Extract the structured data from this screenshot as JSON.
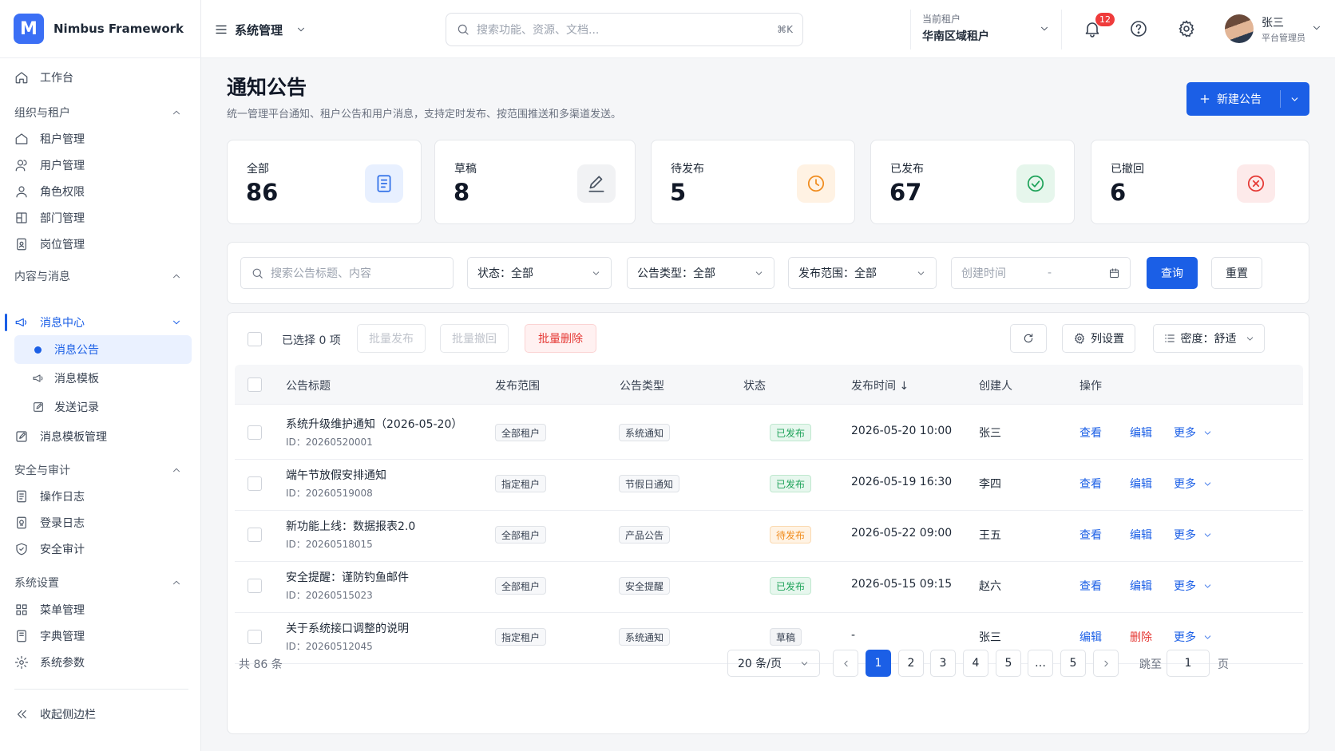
{
  "brand": {
    "logo_letter": "M",
    "name": "Nimbus Framework",
    "accent": "#1b5fe6"
  },
  "sidebar": {
    "workbench": "工作台",
    "groups": [
      {
        "label": "组织与租户",
        "items": [
          "租户管理",
          "用户管理",
          "角色权限",
          "部门管理",
          "岗位管理"
        ]
      },
      {
        "label": "内容与消息",
        "active_item": "消息中心",
        "sub_items": [
          "消息公告",
          "消息模板",
          "发送记录"
        ],
        "items": [
          "消息模板管理"
        ]
      },
      {
        "label": "安全与审计",
        "items": [
          "操作日志",
          "登录日志",
          "安全审计"
        ]
      },
      {
        "label": "系统设置",
        "items": [
          "菜单管理",
          "字典管理",
          "系统参数"
        ]
      }
    ],
    "collapse": "收起侧边栏"
  },
  "topbar": {
    "menu_label": "系统管理",
    "search_placeholder": "搜索功能、资源、文档...",
    "search_shortcut": "⌘K",
    "tenant_label": "当前租户",
    "tenant_value": "华南区域租户",
    "notification_count": "12",
    "user_name": "张三",
    "user_role": "平台管理员"
  },
  "page": {
    "title": "通知公告",
    "description": "统一管理平台通知、租户公告和用户消息，支持定时发布、按范围推送和多渠道发送。",
    "new_button": "新建公告"
  },
  "stats": [
    {
      "label": "全部",
      "value": "86",
      "icon": "document-icon",
      "color": "#2f6fe8",
      "bg": "#e8f0ff"
    },
    {
      "label": "草稿",
      "value": "8",
      "icon": "edit-icon",
      "color": "#4b5563",
      "bg": "#f1f2f4"
    },
    {
      "label": "待发布",
      "value": "5",
      "icon": "clock-icon",
      "color": "#f08c1e",
      "bg": "#fff2e3"
    },
    {
      "label": "已发布",
      "value": "67",
      "icon": "check-circle-icon",
      "color": "#1fa35a",
      "bg": "#e6f6ec"
    },
    {
      "label": "已撤回",
      "value": "6",
      "icon": "x-circle-icon",
      "color": "#e53935",
      "bg": "#fdeaea"
    }
  ],
  "filters": {
    "search_placeholder": "搜索公告标题、内容",
    "status": "状态：全部",
    "type": "公告类型：全部",
    "scope": "发布范围：全部",
    "date_placeholder": "创建时间",
    "date_separator": "-",
    "query_button": "查询",
    "reset_button": "重置"
  },
  "toolbar": {
    "selected": "已选择 0 项",
    "batch_publish": "批量发布",
    "batch_revoke": "批量撤回",
    "batch_delete": "批量删除",
    "columns": "列设置",
    "density": "密度：舒适"
  },
  "table": {
    "columns": [
      "公告标题",
      "发布范围",
      "公告类型",
      "状态",
      "发布时间 ↓",
      "创建人",
      "操作"
    ],
    "rows": [
      {
        "title": "系统升级维护通知（2026-05-20）",
        "id": "ID：20260520001",
        "scope": "全部租户",
        "type": "系统通知",
        "status": "已发布",
        "status_kind": "published",
        "time": "2026-05-20 10:00",
        "creator": "张三",
        "action1": "查看",
        "action2": "编辑",
        "more": "更多"
      },
      {
        "title": "端午节放假安排通知",
        "id": "ID：20260519008",
        "scope": "指定租户",
        "type": "节假日通知",
        "status": "已发布",
        "status_kind": "published",
        "time": "2026-05-19 16:30",
        "creator": "李四",
        "action1": "查看",
        "action2": "编辑",
        "more": "更多"
      },
      {
        "title": "新功能上线：数据报表2.0",
        "id": "ID：20260518015",
        "scope": "全部租户",
        "type": "产品公告",
        "status": "待发布",
        "status_kind": "pending",
        "time": "2026-05-22 09:00",
        "creator": "王五",
        "action1": "查看",
        "action2": "编辑",
        "more": "更多"
      },
      {
        "title": "安全提醒：谨防钓鱼邮件",
        "id": "ID：20260515023",
        "scope": "全部租户",
        "type": "安全提醒",
        "status": "已发布",
        "status_kind": "published",
        "time": "2026-05-15 09:15",
        "creator": "赵六",
        "action1": "查看",
        "action2": "编辑",
        "more": "更多"
      },
      {
        "title": "关于系统接口调整的说明",
        "id": "ID：20260512045",
        "scope": "指定租户",
        "type": "系统通知",
        "status": "草稿",
        "status_kind": "draft",
        "time": "-",
        "creator": "张三",
        "action1": "编辑",
        "action2": "删除",
        "more": "更多"
      }
    ]
  },
  "pagination": {
    "total": "共 86 条",
    "page_size": "20 条/页",
    "pages": [
      "1",
      "2",
      "3",
      "4",
      "5",
      "…",
      "5"
    ],
    "current": "1",
    "jump_label": "跳至",
    "jump_value": "1",
    "jump_unit": "页"
  },
  "status_colors": {
    "published": {
      "fg": "#1fa35a",
      "bg": "#e7f7ee",
      "border": "#bfe8cf"
    },
    "pending": {
      "fg": "#f08c1e",
      "bg": "#fff3e4",
      "border": "#fbd9b0"
    },
    "draft": {
      "fg": "#374151",
      "bg": "#f3f4f6",
      "border": "#dfe2e7"
    }
  }
}
